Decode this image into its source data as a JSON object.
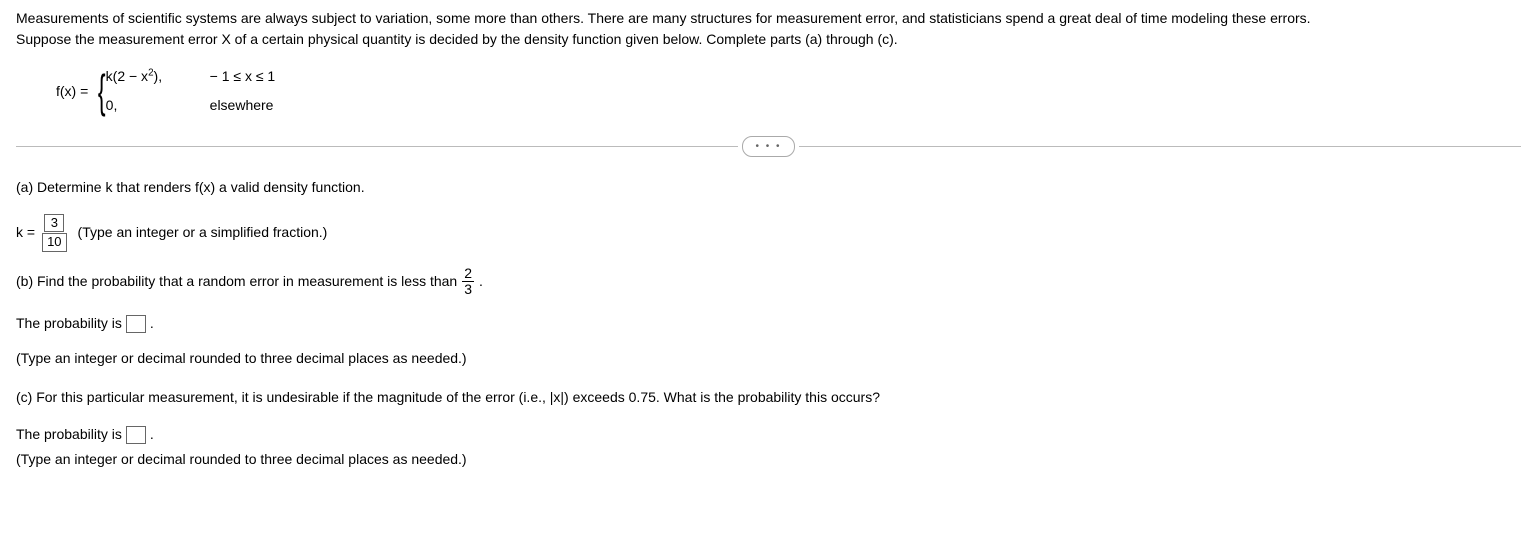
{
  "intro": {
    "line1": "Measurements of scientific systems are always subject to variation, some more than others. There are many structures for measurement error, and statisticians spend a great deal of time modeling these errors.",
    "line2": "Suppose the measurement error X of a certain physical quantity is decided by the density function given below. Complete parts (a) through (c)."
  },
  "formula": {
    "lhs": "f(x) = ",
    "case1_expr_pre": "k",
    "case1_expr_paren": "(2 − x",
    "case1_expr_sup": "2",
    "case1_expr_post": ")",
    "case1_comma": ",",
    "case1_cond": "− 1 ≤ x ≤ 1",
    "case2_expr": "0,",
    "case2_cond": "elsewhere"
  },
  "dots": "• • •",
  "part_a": {
    "prompt": "(a) Determine k that renders f(x) a valid density function.",
    "k_label": "k =",
    "answer_num": "3",
    "answer_den": "10",
    "hint": "(Type an integer or a simplified fraction.)"
  },
  "part_b": {
    "prompt_pre": "(b) Find the probability that a random error in measurement is less than ",
    "frac_num": "2",
    "frac_den": "3",
    "prompt_post": ".",
    "answer_label": "The probability is ",
    "answer_value": "",
    "period": ".",
    "hint": "(Type an integer or decimal rounded to three decimal places as needed.)"
  },
  "part_c": {
    "prompt": "(c) For this particular measurement, it is undesirable if the magnitude of the error (i.e., |x|) exceeds 0.75. What is the probability this occurs?",
    "answer_label": "The probability is ",
    "answer_value": "",
    "period": ".",
    "hint": "(Type an integer or decimal rounded to three decimal places as needed.)"
  }
}
